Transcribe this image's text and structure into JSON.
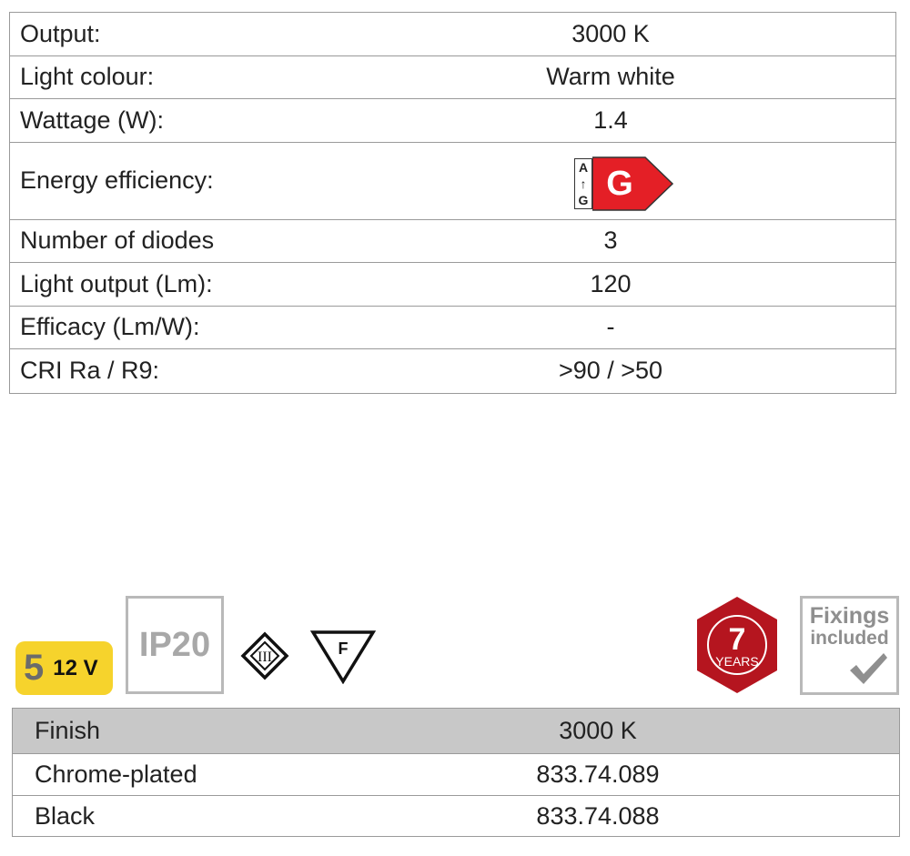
{
  "specs": [
    {
      "label": "Output:",
      "value": "3000 K"
    },
    {
      "label": "Light colour:",
      "value": "Warm white"
    },
    {
      "label": "Wattage (W):",
      "value": "1.4"
    },
    {
      "label": "Energy efficiency:",
      "value": "G",
      "scale_top": "A",
      "scale_arrow": "↑",
      "scale_bottom": "G",
      "badge_color": "#e41f26"
    },
    {
      "label": "Number of diodes",
      "value": "3"
    },
    {
      "label": "Light output (Lm):",
      "value": "120"
    },
    {
      "label": "Efficacy (Lm/W):",
      "value": "-"
    },
    {
      "label": "CRI Ra / R9:",
      "value": ">90 / >50"
    }
  ],
  "icons": {
    "voltage_class": "5",
    "voltage": "12 V",
    "ip_rating": "IP20",
    "protection_class": "III",
    "f_mark": "F",
    "warranty_years": "7",
    "warranty_unit": "YEARS",
    "fixings_line1": "Fixings",
    "fixings_line2": "included",
    "voltage_bg": "#f6d32c",
    "warranty_color": "#b5151f"
  },
  "finish_table": {
    "headers": [
      "Finish",
      "3000 K"
    ],
    "rows": [
      {
        "finish": "Chrome-plated",
        "code": "833.74.089"
      },
      {
        "finish": "Black",
        "code": "833.74.088"
      }
    ]
  }
}
